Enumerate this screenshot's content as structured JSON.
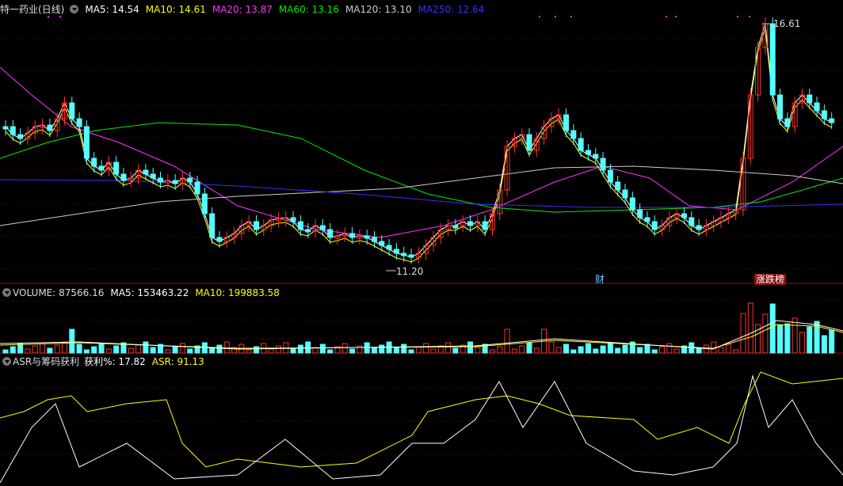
{
  "price_panel": {
    "stock_name": "特一药业(日线)",
    "ma_labels": [
      {
        "text": "MA5: 14.54",
        "color": "#ffffff"
      },
      {
        "text": "MA10: 14.61",
        "color": "#ffff00"
      },
      {
        "text": "MA20: 13.87",
        "color": "#ff33ff"
      },
      {
        "text": "MA60: 13.16",
        "color": "#00ee00"
      },
      {
        "text": "MA120: 13.10",
        "color": "#cccccc"
      },
      {
        "text": "MA250: 12.64",
        "color": "#3333ff"
      }
    ],
    "high_label": "16.61",
    "low_label": "11.20",
    "tag_finance": "财",
    "tag_list": "涨跌榜"
  },
  "volume_panel": {
    "labels": [
      {
        "text": "VOLUME: 87566.16",
        "color": "#dddddd"
      },
      {
        "text": "MA5: 153463.22",
        "color": "#ffffff"
      },
      {
        "text": "MA10: 199883.58",
        "color": "#ffff00"
      }
    ]
  },
  "asr_panel": {
    "title": "ASR与筹码获利",
    "labels": [
      {
        "text": "获利%: 17.82",
        "color": "#ffffff"
      },
      {
        "text": "ASR: 91.13",
        "color": "#ffff00"
      }
    ]
  },
  "colors": {
    "up": "#ff3232",
    "down": "#54ffff",
    "grid": "#7a0000",
    "background": "#000000"
  }
}
